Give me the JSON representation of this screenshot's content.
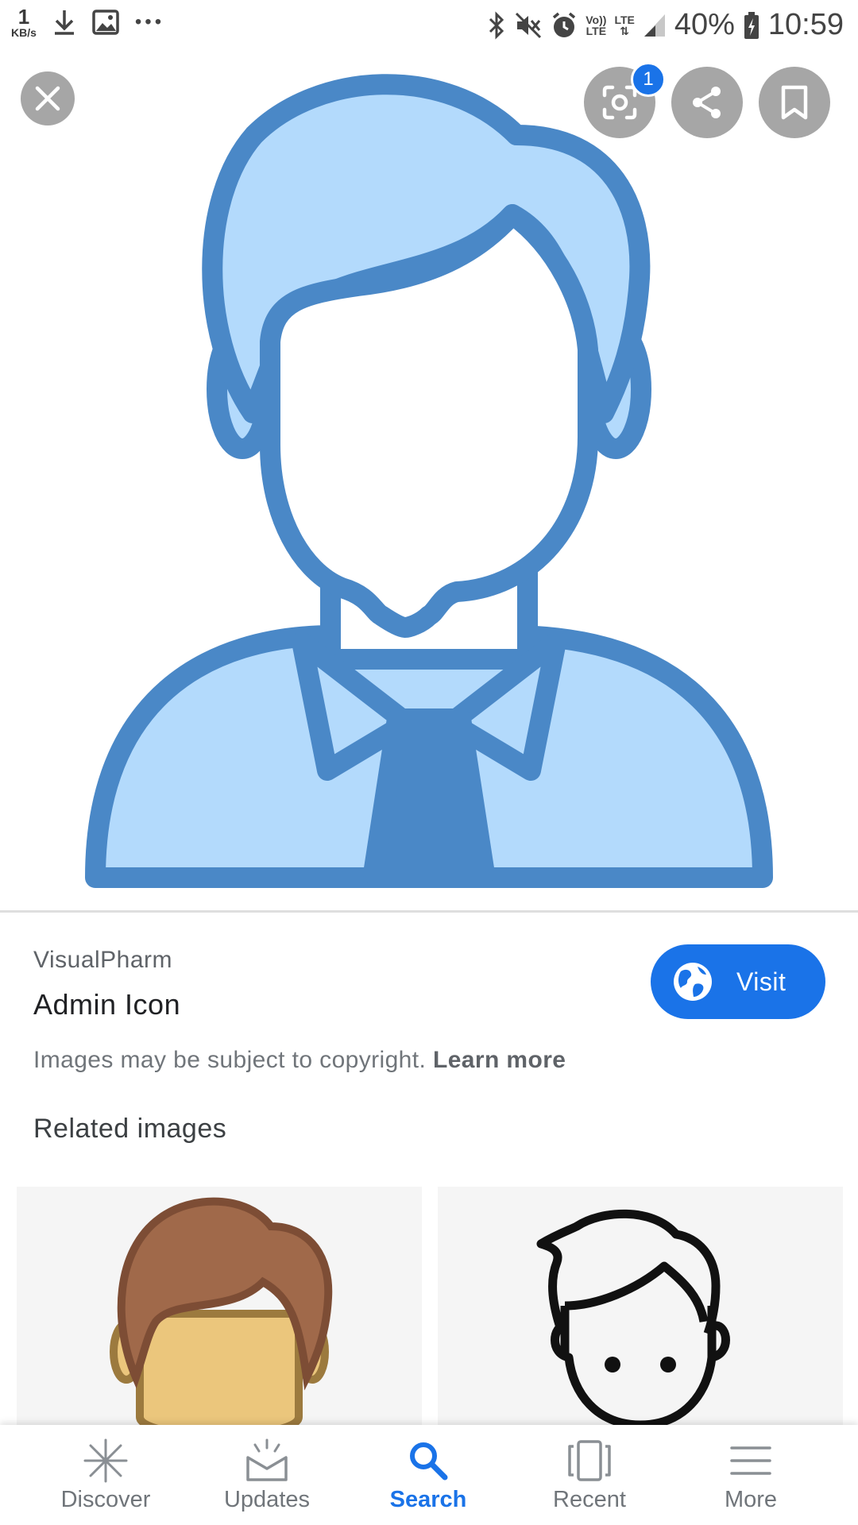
{
  "status_bar": {
    "speed_value": "1",
    "speed_unit": "KB/s",
    "overflow": "•••",
    "volte_top": "Vo))",
    "volte_bottom": "LTE",
    "lte": "LTE",
    "battery": "40%",
    "time": "10:59"
  },
  "viewer": {
    "lens_badge": "1"
  },
  "result": {
    "source": "VisualPharm",
    "title": "Admin Icon",
    "visit_label": "Visit",
    "copyright_text": "Images may be subject to copyright.",
    "learn_more": "Learn more"
  },
  "related": {
    "heading": "Related images"
  },
  "bottom_nav": {
    "discover": "Discover",
    "updates": "Updates",
    "search": "Search",
    "recent": "Recent",
    "more": "More"
  },
  "colors": {
    "accent": "#1a73e8",
    "icon_stroke": "#4a88c7",
    "icon_fill": "#b3dafc"
  }
}
